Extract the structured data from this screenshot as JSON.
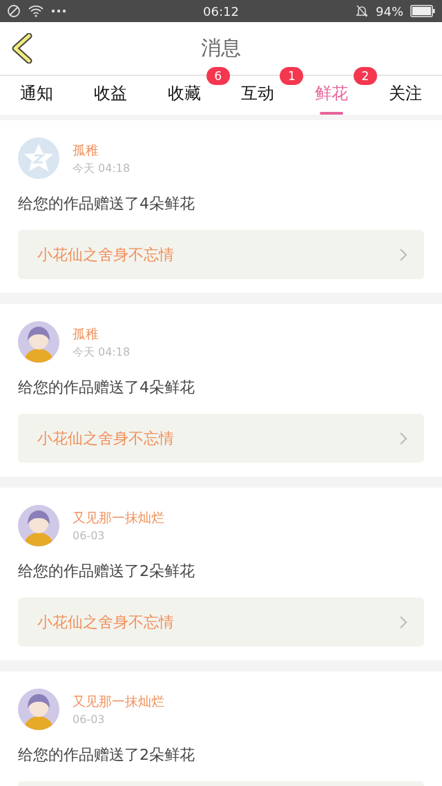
{
  "status_bar": {
    "time": "06:12",
    "battery_text": "94%"
  },
  "header": {
    "title": "消息"
  },
  "tabs": [
    {
      "label": "通知",
      "selected": false
    },
    {
      "label": "收益",
      "selected": false
    },
    {
      "label": "收藏",
      "selected": false,
      "badge": "6"
    },
    {
      "label": "互动",
      "selected": false,
      "badge": "1"
    },
    {
      "label": "鲜花",
      "selected": true,
      "badge": "2"
    },
    {
      "label": "关注",
      "selected": false
    }
  ],
  "messages": [
    {
      "avatar": {
        "kind": "default"
      },
      "name": "孤稚",
      "time": "今天 04:18",
      "text": "给您的作品赠送了4朵鲜花",
      "work": "小花仙之舍身不忘情"
    },
    {
      "avatar": {
        "kind": "character"
      },
      "name": "孤稚",
      "time": "今天 04:18",
      "text": "给您的作品赠送了4朵鲜花",
      "work": "小花仙之舍身不忘情"
    },
    {
      "avatar": {
        "kind": "character"
      },
      "name": "又见那一抹灿烂",
      "time": "06-03",
      "text": "给您的作品赠送了2朵鲜花",
      "work": "小花仙之舍身不忘情"
    },
    {
      "avatar": {
        "kind": "character"
      },
      "name": "又见那一抹灿烂",
      "time": "06-03",
      "text": "给您的作品赠送了2朵鲜花"
    }
  ]
}
